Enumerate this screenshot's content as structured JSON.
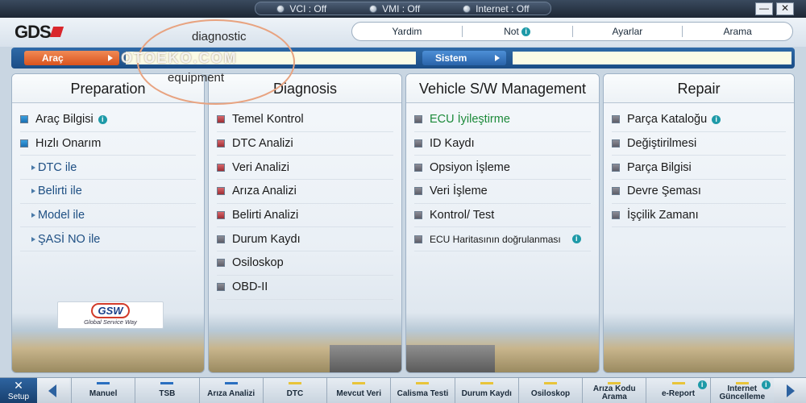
{
  "status": {
    "items": [
      {
        "label": "VCI : Off"
      },
      {
        "label": "VMI : Off"
      },
      {
        "label": "Internet : Off"
      }
    ],
    "minimize": "—",
    "close": "✕"
  },
  "header": {
    "logo": "GDS",
    "nav": [
      "Yardim",
      "Not",
      "Ayarlar",
      "Arama"
    ]
  },
  "selection": {
    "vehicle_label": "Araç",
    "vehicle_value": "",
    "system_label": "Sistem",
    "system_value": ""
  },
  "watermark": {
    "top": "diagnostic",
    "middle": "OTOEKO.COM",
    "bottom": "equipment"
  },
  "panels": {
    "preparation": {
      "title": "Preparation",
      "items": [
        "Araç Bilgisi",
        "Hızlı Onarım",
        "DTC ile",
        "Belirti ile",
        "Model ile",
        "ŞASİ NO ile"
      ]
    },
    "diagnosis": {
      "title": "Diagnosis",
      "items": [
        "Temel Kontrol",
        "DTC Analizi",
        "Veri Analizi",
        "Arıza Analizi",
        "Belirti Analizi",
        "Durum Kaydı",
        "Osiloskop",
        "OBD-II"
      ]
    },
    "vehicle_sw": {
      "title": "Vehicle S/W Management",
      "items": [
        "ECU İyileştirme",
        "ID Kaydı",
        "Opsiyon İşleme",
        "Veri İşleme",
        "Kontrol/ Test",
        "ECU Haritasının doğrulanması"
      ]
    },
    "repair": {
      "title": "Repair",
      "items": [
        "Parça Kataloğu",
        "Değiştirilmesi",
        "Parça Bilgisi",
        "Devre Şeması",
        "İşçilik Zamanı"
      ]
    }
  },
  "gsw": {
    "logo": "GSW",
    "tagline": "Global Service Way"
  },
  "toolbar": {
    "setup": "Setup",
    "buttons": [
      "Manuel",
      "TSB",
      "Arıza Analizi",
      "DTC",
      "Mevcut Veri",
      "Calisma Testi",
      "Durum Kaydı",
      "Osiloskop",
      "Arıza Kodu Arama",
      "e-Report",
      "Internet Güncelleme"
    ]
  },
  "colors": {
    "accent_orange": "#d9531e",
    "accent_blue": "#2a64aa",
    "highlight_green": "#1c8a3a",
    "info": "#1e9aa8"
  }
}
